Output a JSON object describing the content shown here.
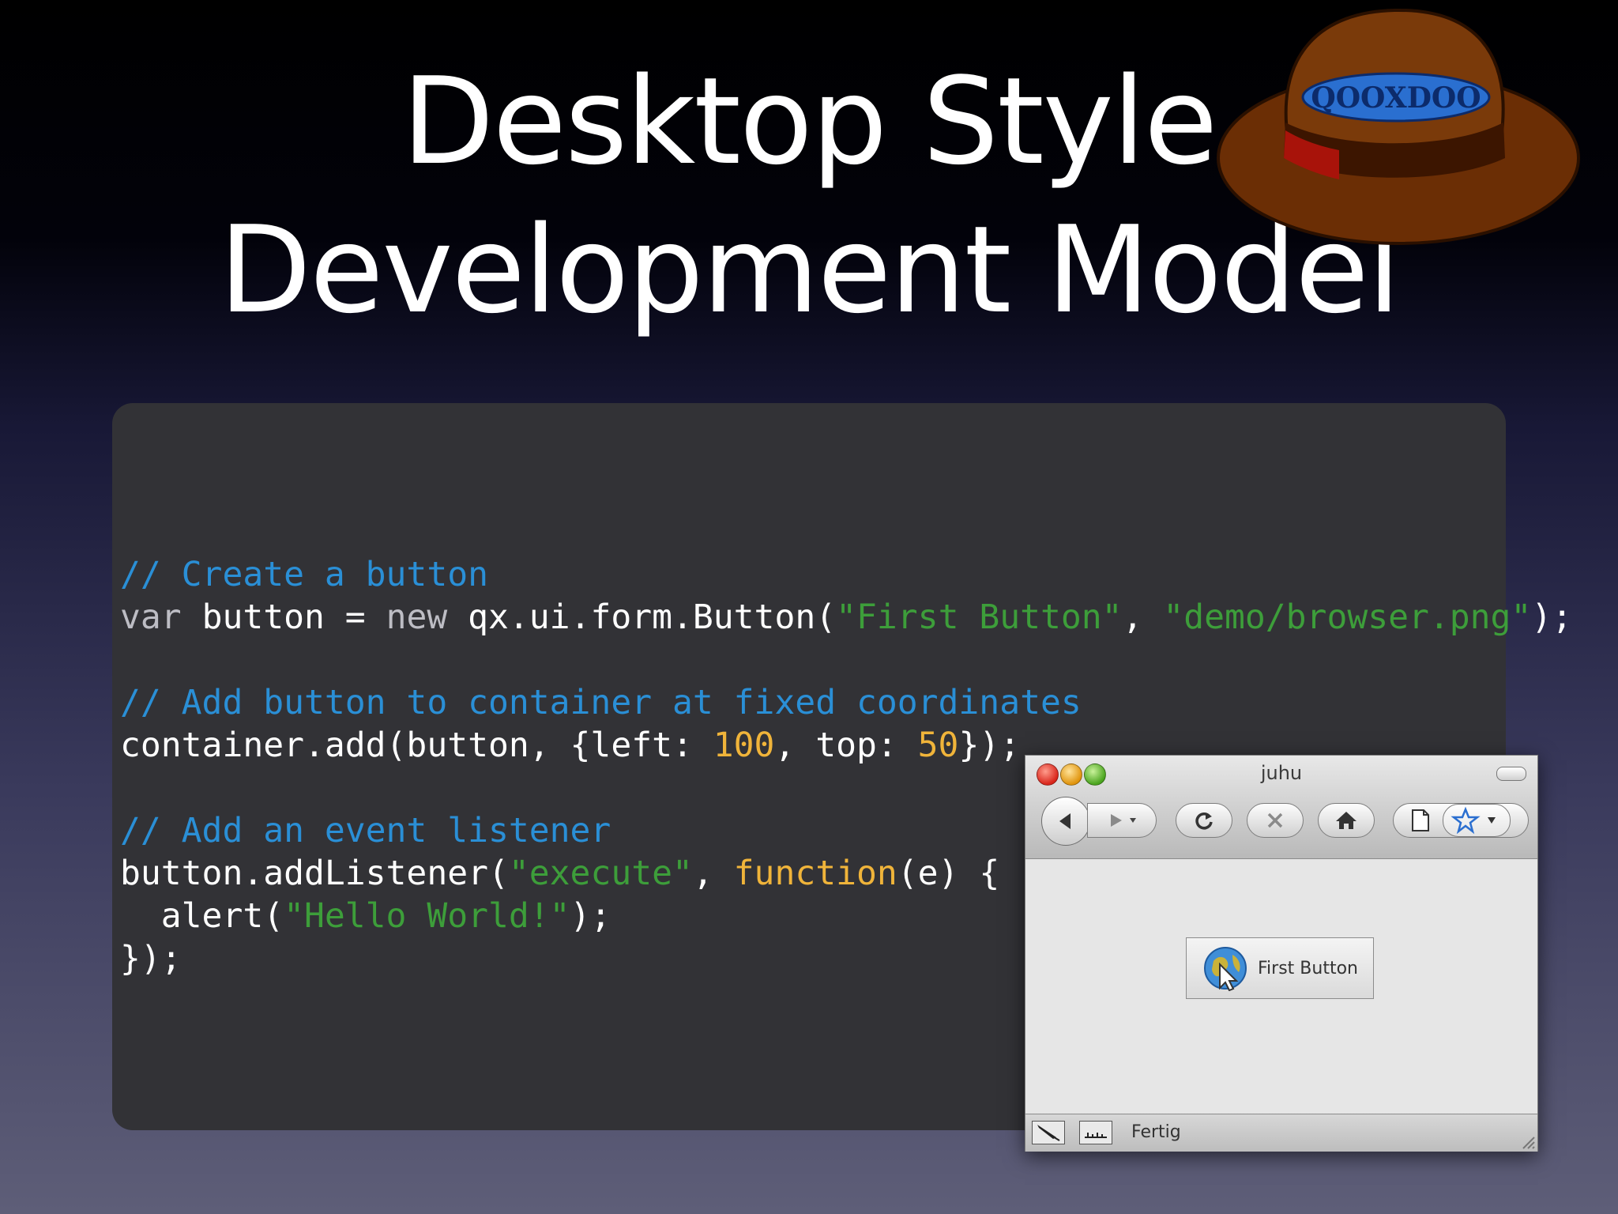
{
  "slide": {
    "title_line1": "Desktop Style",
    "title_line2": "Development Model",
    "logo_text": "QOOXDOO"
  },
  "code": {
    "line1": "// Create a button",
    "line2_pre": "var ",
    "line2_a": "button = ",
    "line2_new": "new ",
    "line2_b": "qx.ui.form.Button(",
    "line2_str1": "\"First Button\"",
    "line2_c": ", ",
    "line2_str2": "\"demo/browser.png\"",
    "line2_d": ");",
    "line4": "// Add button to container at fixed coordinates",
    "line5_a": "container.add(button, {left: ",
    "line5_n1": "100",
    "line5_b": ", top: ",
    "line5_n2": "50",
    "line5_c": "});",
    "line7": "// Add an event listener",
    "line8_a": "button.addListener(",
    "line8_str": "\"execute\"",
    "line8_b": ", ",
    "line8_kw": "function",
    "line8_c": "(e) {",
    "line9_a": "  alert(",
    "line9_str": "\"Hello World!\"",
    "line9_b": ");",
    "line10": "});"
  },
  "browser": {
    "window_title": "juhu",
    "button_label": "First Button",
    "status_text": "Fertig",
    "toolbar_icons": [
      "back-arrow-icon",
      "forward-arrow-icon",
      "reload-icon",
      "stop-icon",
      "home-icon",
      "page-icon",
      "star-icon"
    ]
  },
  "colors": {
    "comment": "#2a8fd6",
    "string": "#3d9e3a",
    "number": "#f0b43a",
    "panel": "#323236",
    "hat": "#6b2e05"
  }
}
